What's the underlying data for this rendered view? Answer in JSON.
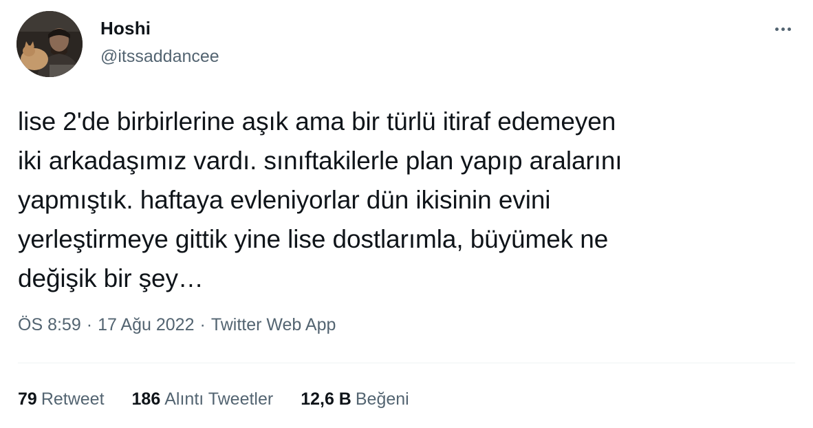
{
  "author": {
    "display_name": "Hoshi",
    "handle": "@itssaddancee"
  },
  "tweet": {
    "text": "lise 2'de birbirlerine aşık ama bir türlü itiraf edemeyen\niki arkadaşımız vardı. sınıftakilerle plan yapıp aralarını\nyapmıştık. haftaya evleniyorlar dün ikisinin evini\nyerleştirmeye gittik yine lise dostlarımla, büyümek ne\ndeğişik bir şey…",
    "time": "ÖS 8:59",
    "date": "17 Ağu 2022",
    "separator": "·",
    "source": "Twitter Web App"
  },
  "stats": {
    "retweets": {
      "count": "79",
      "label": "Retweet"
    },
    "quotes": {
      "count": "186",
      "label": "Alıntı Tweetler"
    },
    "likes": {
      "count": "12,6 B",
      "label": "Beğeni"
    }
  },
  "icons": {
    "more": "more-horizontal-icon"
  },
  "colors": {
    "text_primary": "#0f1419",
    "text_secondary": "#536471",
    "divider": "#eff3f4",
    "background": "#ffffff"
  }
}
